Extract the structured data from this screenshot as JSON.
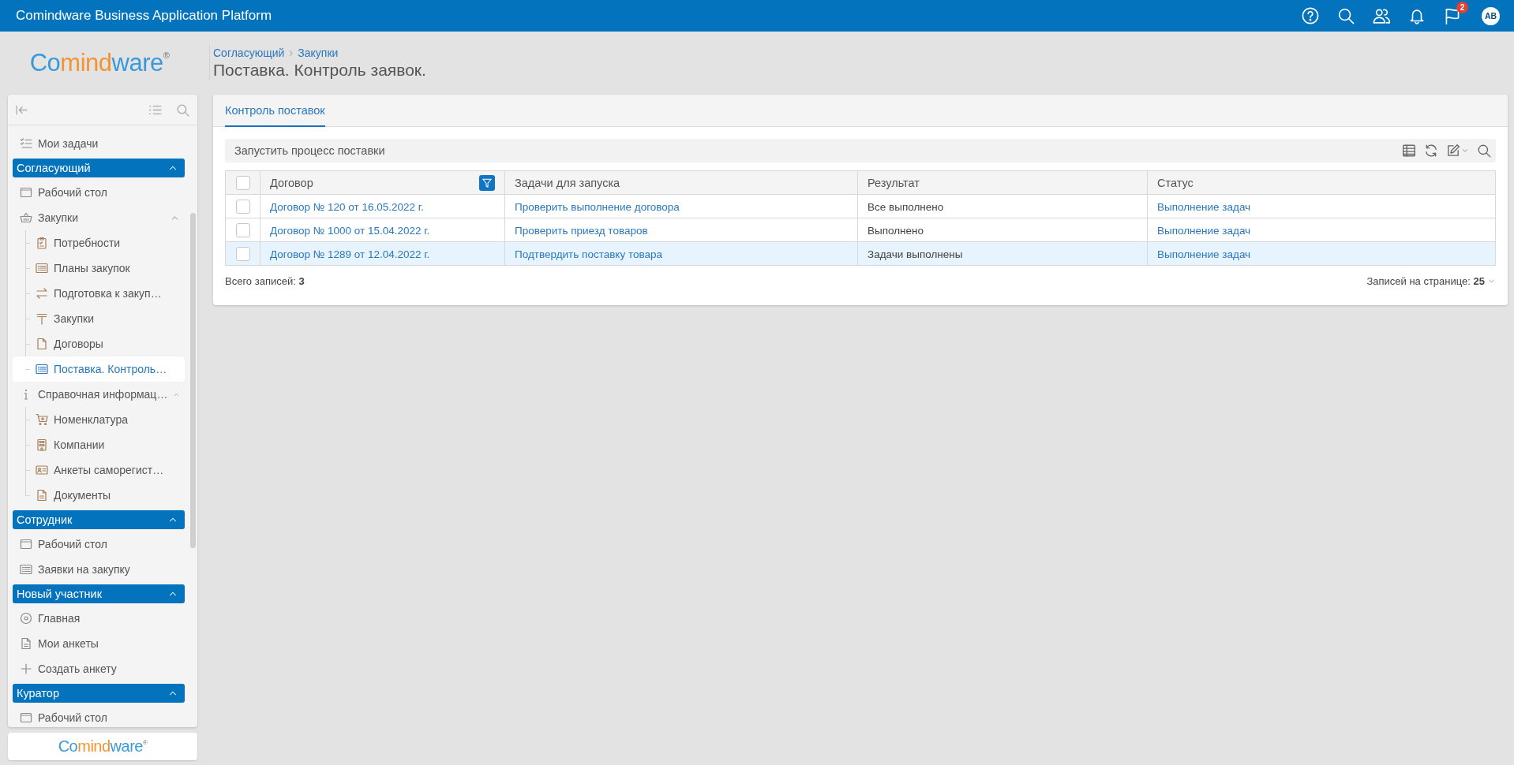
{
  "topbar": {
    "title": "Comindware Business Application Platform",
    "badge": "2",
    "avatar": "AB"
  },
  "logo": {
    "segments": [
      {
        "text": "Co",
        "color": "#3a9ad9"
      },
      {
        "text": "mind",
        "color": "#f39433"
      },
      {
        "text": "ware",
        "color": "#3a9ad9"
      }
    ],
    "mark": "®"
  },
  "breadcrumb": [
    {
      "label": "Согласующий"
    },
    {
      "label": "Закупки"
    }
  ],
  "page_title": "Поставка. Контроль заявок.",
  "sidebar": {
    "items": [
      {
        "kind": "item",
        "label": "Мои задачи",
        "selected": false
      },
      {
        "kind": "group",
        "label": "Согласующий",
        "expanded": true,
        "children": [
          {
            "kind": "item",
            "label": "Рабочий стол",
            "selected": false
          },
          {
            "kind": "item",
            "label": "Закупки",
            "selected": false,
            "expanded": true,
            "children": [
              {
                "kind": "item",
                "label": "Потребности",
                "selected": false
              },
              {
                "kind": "item",
                "label": "Планы закупок",
                "selected": false
              },
              {
                "kind": "item",
                "label": "Подготовка к закуп…",
                "selected": false
              },
              {
                "kind": "item",
                "label": "Закупки",
                "selected": false
              },
              {
                "kind": "item",
                "label": "Договоры",
                "selected": false
              },
              {
                "kind": "item",
                "label": "Поставка. Контроль…",
                "selected": true
              }
            ]
          },
          {
            "kind": "item",
            "label": "Справочная информац…",
            "selected": false,
            "expanded": true,
            "children": [
              {
                "kind": "item",
                "label": "Номенклатура",
                "selected": false
              },
              {
                "kind": "item",
                "label": "Компании",
                "selected": false
              },
              {
                "kind": "item",
                "label": "Анкеты саморегист…",
                "selected": false
              },
              {
                "kind": "item",
                "label": "Документы",
                "selected": false
              }
            ]
          }
        ]
      },
      {
        "kind": "group",
        "label": "Сотрудник",
        "expanded": true,
        "children": [
          {
            "kind": "item",
            "label": "Рабочий стол",
            "selected": false
          },
          {
            "kind": "item",
            "label": "Заявки на закупку",
            "selected": false
          }
        ]
      },
      {
        "kind": "group",
        "label": "Новый участник",
        "expanded": true,
        "children": [
          {
            "kind": "item",
            "label": "Главная",
            "selected": false
          },
          {
            "kind": "item",
            "label": "Мои анкеты",
            "selected": false
          },
          {
            "kind": "item",
            "label": "Создать анкету",
            "selected": false
          }
        ]
      },
      {
        "kind": "group",
        "label": "Куратор",
        "expanded": true,
        "children": [
          {
            "kind": "item",
            "label": "Рабочий стол",
            "selected": false
          }
        ]
      }
    ]
  },
  "footer_logo": {
    "segments": [
      {
        "text": "Co",
        "color": "#3a9ad9"
      },
      {
        "text": "mind",
        "color": "#f39433"
      },
      {
        "text": "ware",
        "color": "#3a9ad9"
      }
    ],
    "mark": "®"
  },
  "tabs": [
    {
      "label": "Контроль поставок",
      "selected": true
    }
  ],
  "toolbar": {
    "button": "Запустить процесс поставки"
  },
  "table": {
    "all_checked": false,
    "columns": [
      {
        "label": "Договор",
        "kind": "link",
        "filtered": true
      },
      {
        "label": "Задачи для запуска",
        "kind": "link",
        "filtered": false
      },
      {
        "label": "Результат",
        "kind": "text",
        "filtered": false
      },
      {
        "label": "Статус",
        "kind": "link",
        "filtered": false
      }
    ],
    "rows": [
      {
        "checked": false,
        "selected": false,
        "cells": [
          "Договор № 120 от 16.05.2022 г.",
          "Проверить выполнение договора",
          "Все выполнено",
          "Выполнение задач"
        ]
      },
      {
        "checked": false,
        "selected": false,
        "cells": [
          "Договор № 1000 от 15.04.2022 г.",
          "Проверить приезд товаров",
          "Выполнено",
          "Выполнение задач"
        ]
      },
      {
        "checked": false,
        "selected": true,
        "cells": [
          "Договор № 1289 от 12.04.2022 г.",
          "Подтвердить поставку товара",
          "Задачи выполнены",
          "Выполнение задач"
        ]
      }
    ]
  },
  "total": "Всего записей: **3**",
  "page_size": "Записей на странице: **25**"
}
